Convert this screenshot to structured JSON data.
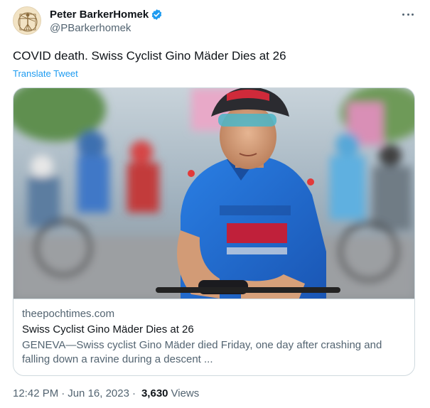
{
  "tweet": {
    "author": {
      "display_name": "Peter BarkerHomek",
      "handle": "@PBarkerhomek",
      "verified": true,
      "verified_color": "#1d9bf0"
    },
    "text": "COVID death. Swiss Cyclist Gino Mäder Dies at 26",
    "translate_label": "Translate Tweet",
    "card": {
      "domain": "theepochtimes.com",
      "title": "Swiss Cyclist Gino Mäder Dies at 26",
      "description": "GENEVA—Swiss cyclist Gino Mäder died Friday, one day after crashing and falling down a ravine during a descent ...",
      "image_colors": {
        "jersey": "#1f6fd6",
        "sky": "#b9c8d6",
        "road": "#a7a9ab",
        "foliage": "#5f8f4f",
        "skin": "#d8a27d"
      }
    },
    "meta": {
      "time": "12:42 PM",
      "separator": "·",
      "date": "Jun 16, 2023",
      "views_count": "3,630",
      "views_label": "Views"
    },
    "icons": {
      "more": "more-dots-icon",
      "verified": "verified-badge-icon"
    }
  }
}
